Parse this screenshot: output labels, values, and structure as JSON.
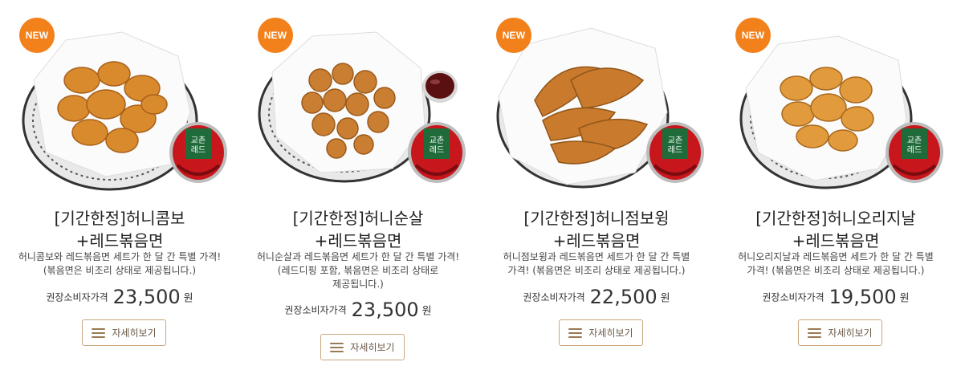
{
  "products": [
    {
      "badge": "NEW",
      "title_line1": "[기간한정]허니콤보",
      "title_line2": "+레드볶음면",
      "desc_lines": [
        "허니콤보와 레드볶음면 세트가 한 달 간 특별 가격!",
        "(볶음면은 비조리 상태로 제공됩니다.)"
      ],
      "price_label": "권장소비자가격",
      "price": "23,500",
      "currency": "원",
      "detail_button": "자세히보기",
      "extras": [
        "basket-with-chicken",
        "noodle-cup"
      ]
    },
    {
      "badge": "NEW",
      "title_line1": "[기간한정]허니순살",
      "title_line2": "+레드볶음면",
      "desc_lines": [
        "허니순살과 레드볶음면 세트가 한 달 간 특별 가격!",
        "(레드디핑 포함, 볶음면은 비조리 상태로",
        "제공됩니다.)"
      ],
      "price_label": "권장소비자가격",
      "price": "23,500",
      "currency": "원",
      "detail_button": "자세히보기",
      "extras": [
        "basket-with-chicken",
        "noodle-cup",
        "dipping-sauce"
      ]
    },
    {
      "badge": "NEW",
      "title_line1": "[기간한정]허니점보윙",
      "title_line2": "+레드볶음면",
      "desc_lines": [
        "허니점보윙과 레드볶음면 세트가 한 달 간 특별",
        "가격! (볶음면은 비조리 상태로 제공됩니다.)"
      ],
      "price_label": "권장소비자가격",
      "price": "22,500",
      "currency": "원",
      "detail_button": "자세히보기",
      "extras": [
        "basket-with-chicken",
        "noodle-cup"
      ]
    },
    {
      "badge": "NEW",
      "title_line1": "[기간한정]허니오리지날",
      "title_line2": "+레드볶음면",
      "desc_lines": [
        "허니오리지날과 레드볶음면 세트가 한 달 간 특별",
        "가격! (볶음면은 비조리 상태로 제공됩니다.)"
      ],
      "price_label": "권장소비자가격",
      "price": "19,500",
      "currency": "원",
      "detail_button": "자세히보기",
      "extras": [
        "basket-with-chicken",
        "noodle-cup"
      ]
    }
  ],
  "noodle_cup_label": [
    "교촌",
    "레드"
  ],
  "colors": {
    "badge": "#f2801b",
    "button_border": "#c9a77f",
    "chicken": "#d88a2c",
    "cup_red": "#c8161d",
    "cup_green": "#1f6b3a"
  }
}
